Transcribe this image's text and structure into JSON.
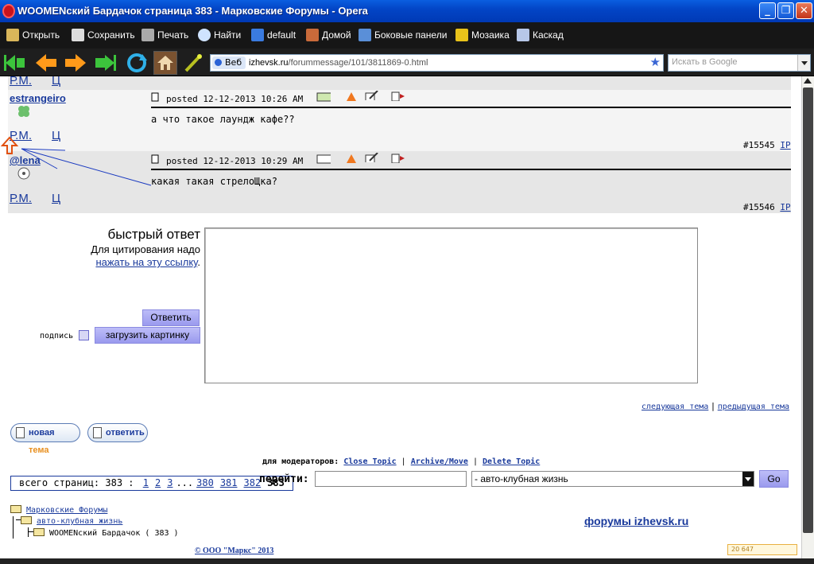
{
  "window": {
    "title": "WOOMENский Бардачок страница 383 - Марковские Форумы - Opera",
    "minimize": "_",
    "maximize": "❐",
    "close": "✕"
  },
  "menu": {
    "items": [
      {
        "label": "Открыть",
        "icon": "folder-icon"
      },
      {
        "label": "Сохранить",
        "icon": "save-icon"
      },
      {
        "label": "Печать",
        "icon": "printer-icon"
      },
      {
        "label": "Найти",
        "icon": "search-icon"
      },
      {
        "label": "default",
        "icon": "play-icon"
      },
      {
        "label": "Домой",
        "icon": "home-icon"
      },
      {
        "label": "Боковые панели",
        "icon": "panels-icon"
      },
      {
        "label": "Мозаика",
        "icon": "tile-icon"
      },
      {
        "label": "Каскад",
        "icon": "cascade-icon"
      }
    ]
  },
  "nav": {
    "veb_label": "Веб",
    "url_host": "izhevsk.ru",
    "url_path": "/forummessage/101/3811869-0.html",
    "search_placeholder": "Искать в Google"
  },
  "posts": [
    {
      "username": "estrangeiro",
      "posted": "posted 12-12-2013 10:26 AM",
      "message": "а что такое лаундж кафе??",
      "number": "#15545",
      "ip": "IP",
      "pm": "Р.М.",
      "q": "Ц"
    },
    {
      "username": "@lena",
      "posted": "posted 12-12-2013 10:29 AM",
      "message": "какая такая стрелоЩка?",
      "number": "#15546",
      "ip": "IP",
      "pm": "Р.М.",
      "q": "Ц"
    }
  ],
  "top_pm": "Р.М.",
  "top_q": "Ц",
  "quick_reply": {
    "title": "быстрый ответ",
    "hint": "Для цитирования надо",
    "link": "нажать на эту ссылку",
    "submit": "Ответить",
    "signature_label": "подпись",
    "upload": "загрузить картинку"
  },
  "pager": {
    "label": "всего страниц: 383 :",
    "pages": [
      "1",
      "2",
      "3"
    ],
    "ellipsis": "...",
    "pages_end": [
      "380",
      "381",
      "382"
    ],
    "current": "383"
  },
  "topic_nav": {
    "next": "следующая тема",
    "sep": "|",
    "prev": "предыдущая тема"
  },
  "buttons": {
    "new_topic_a": "новая",
    "new_topic_b": "тема",
    "reply": "ответить"
  },
  "moderators": {
    "label": "для модераторов:",
    "close": "Close Topic",
    "archive": "Archive/Move",
    "delete": "Delete Topic",
    "sep": "|"
  },
  "goto": {
    "label": "перейти:",
    "selected": "- авто-клубная жизнь",
    "go": "Go"
  },
  "tree": {
    "root": "Марковские Форумы",
    "sub": "авто-клубная жизнь",
    "leaf": "WOOMENский Бардачок ( 383 )"
  },
  "footer": {
    "forums_link": "форумы izhevsk.ru",
    "copyright": "© ООО \"Маркс\" 2013",
    "counter": "20 647"
  }
}
